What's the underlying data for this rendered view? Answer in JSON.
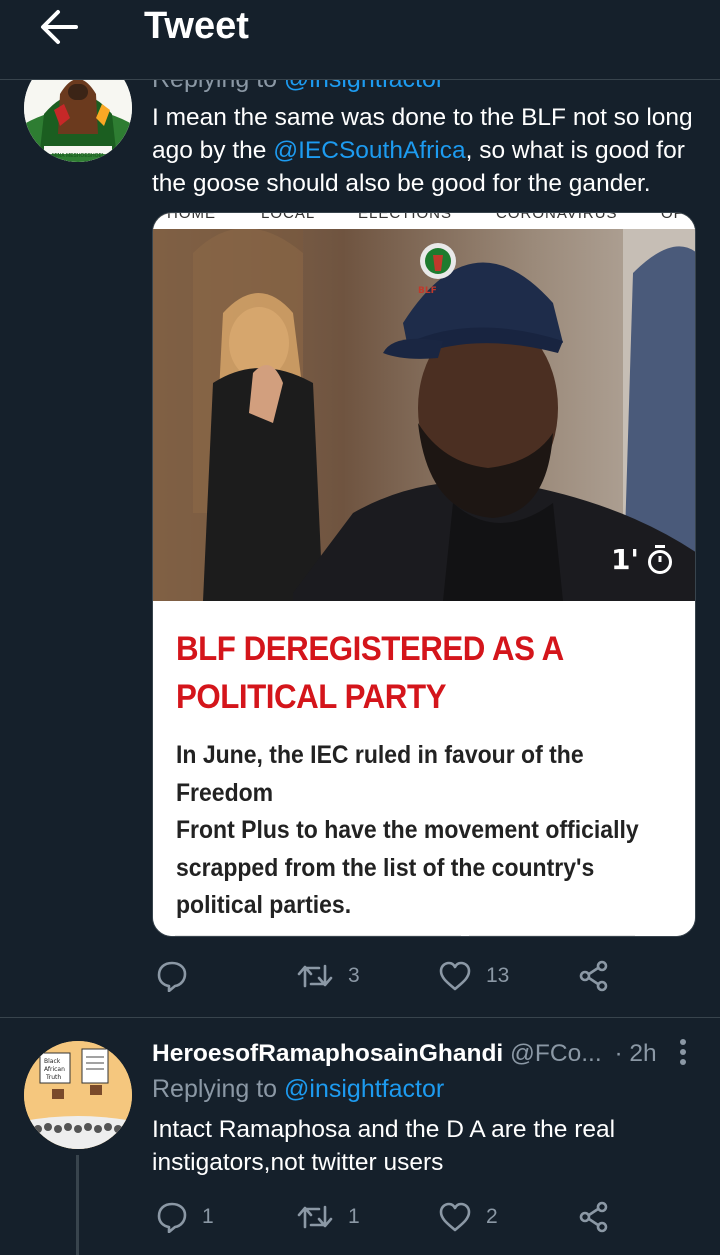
{
  "header": {
    "title": "Tweet",
    "back_icon": "arrow-left-icon"
  },
  "tweet1": {
    "replying_prefix": "Replying to",
    "replying_handle": "@insightfactor",
    "text_lines": [
      "I mean the same was done to the BLF not so long",
      "ago by the ",
      ", so what is good for",
      "the goose should also be good for the gander."
    ],
    "mention": "@IECSouthAfrica",
    "card": {
      "nav_items": [
        "HOME",
        "LOCAL",
        "ELECTIONS",
        "CORONAVIRUS",
        "OP"
      ],
      "cap_badge": "BLF",
      "read_time": "1'",
      "headline_lines": [
        "BLF DEREGISTERED AS A",
        "POLITICAL PARTY"
      ],
      "summary_lines": [
        "In June, the IEC ruled in favour of the Freedom",
        "Front Plus to have the movement officially",
        "scrapped from the list of the country's",
        "political parties."
      ],
      "headline_color": "#d4151b"
    },
    "actions": {
      "reply_count": "",
      "retweet_count": "3",
      "like_count": "13"
    },
    "avatar_caption": "MINA MESHOESHOE!"
  },
  "tweet2": {
    "name": "HeroesofRamaphosainGhandi",
    "handle": "@FCo...",
    "time": "· 2h",
    "replying_prefix": "Replying to",
    "replying_handle": "@insightfactor",
    "text_lines": [
      "Intact Ramaphosa and the D A are the real",
      "instigators,not twitter users"
    ],
    "actions": {
      "reply_count": "1",
      "retweet_count": "1",
      "like_count": "2"
    },
    "avatar_signs": [
      "Black",
      "African",
      "Truth"
    ]
  },
  "colors": {
    "background": "#15202b",
    "accent": "#1d9bf0",
    "muted": "#8b98a5",
    "divider": "#38444d"
  }
}
